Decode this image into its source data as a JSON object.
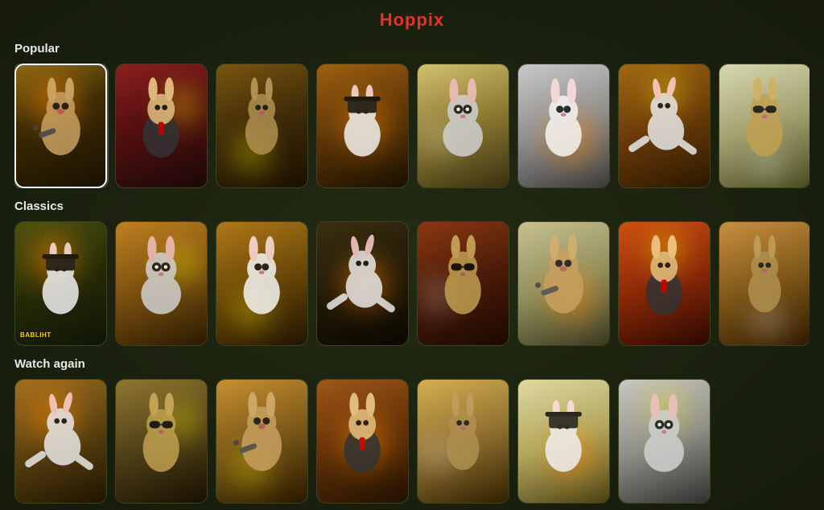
{
  "app": {
    "title": "Hoppix"
  },
  "sections": [
    {
      "id": "popular",
      "label": "Popular",
      "cards": [
        {
          "id": "p1",
          "theme": "theme-1",
          "selected": true,
          "overlay": ""
        },
        {
          "id": "p2",
          "theme": "theme-2",
          "selected": false,
          "overlay": ""
        },
        {
          "id": "p3",
          "theme": "theme-3",
          "selected": false,
          "overlay": ""
        },
        {
          "id": "p4",
          "theme": "theme-4",
          "selected": false,
          "overlay": ""
        },
        {
          "id": "p5",
          "theme": "theme-5",
          "selected": false,
          "overlay": ""
        },
        {
          "id": "p6",
          "theme": "theme-6",
          "selected": false,
          "overlay": ""
        },
        {
          "id": "p7",
          "theme": "theme-7",
          "selected": false,
          "overlay": ""
        },
        {
          "id": "p8",
          "theme": "theme-8",
          "selected": false,
          "overlay": ""
        }
      ]
    },
    {
      "id": "classics",
      "label": "Classics",
      "cards": [
        {
          "id": "c1",
          "theme": "theme-c1",
          "selected": false,
          "overlay": "BABLIHT"
        },
        {
          "id": "c2",
          "theme": "theme-c2",
          "selected": false,
          "overlay": ""
        },
        {
          "id": "c3",
          "theme": "theme-c3",
          "selected": false,
          "overlay": ""
        },
        {
          "id": "c4",
          "theme": "theme-c4",
          "selected": false,
          "overlay": ""
        },
        {
          "id": "c5",
          "theme": "theme-c5",
          "selected": false,
          "overlay": ""
        },
        {
          "id": "c6",
          "theme": "theme-c6",
          "selected": false,
          "overlay": ""
        },
        {
          "id": "c7",
          "theme": "theme-c7",
          "selected": false,
          "overlay": ""
        },
        {
          "id": "c8",
          "theme": "theme-c8",
          "selected": false,
          "overlay": ""
        }
      ]
    },
    {
      "id": "watch-again",
      "label": "Watch again",
      "cards": [
        {
          "id": "w1",
          "theme": "theme-w1",
          "selected": false,
          "overlay": ""
        },
        {
          "id": "w2",
          "theme": "theme-w2",
          "selected": false,
          "overlay": ""
        },
        {
          "id": "w3",
          "theme": "theme-w3",
          "selected": false,
          "overlay": ""
        },
        {
          "id": "w4",
          "theme": "theme-w4",
          "selected": false,
          "overlay": ""
        },
        {
          "id": "w5",
          "theme": "theme-w5",
          "selected": false,
          "overlay": ""
        },
        {
          "id": "w6",
          "theme": "theme-w6",
          "selected": false,
          "overlay": ""
        },
        {
          "id": "w7",
          "theme": "theme-w7",
          "selected": false,
          "overlay": ""
        }
      ]
    }
  ]
}
